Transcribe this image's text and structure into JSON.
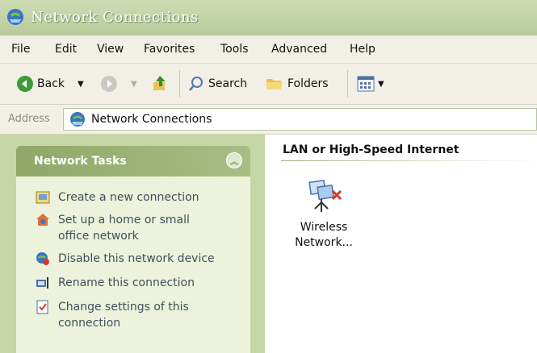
{
  "window": {
    "title": "Network Connections"
  },
  "menu": [
    "File",
    "Edit",
    "View",
    "Favorites",
    "Tools",
    "Advanced",
    "Help"
  ],
  "toolbar": {
    "back": "Back",
    "search": "Search",
    "folders": "Folders"
  },
  "address": {
    "label": "Address",
    "value": "Network Connections"
  },
  "tasks": {
    "title": "Network Tasks",
    "items": [
      {
        "lines": [
          "Create a new connection"
        ]
      },
      {
        "lines": [
          "Set up a home or small",
          "office network"
        ]
      },
      {
        "lines": [
          "Disable this network device"
        ]
      },
      {
        "lines": [
          "Rename this connection"
        ]
      },
      {
        "lines": [
          "Change settings of this",
          "connection"
        ]
      }
    ]
  },
  "content": {
    "group_title": "LAN or High-Speed Internet",
    "item": {
      "line1": "Wireless",
      "line2": "Network..."
    }
  }
}
